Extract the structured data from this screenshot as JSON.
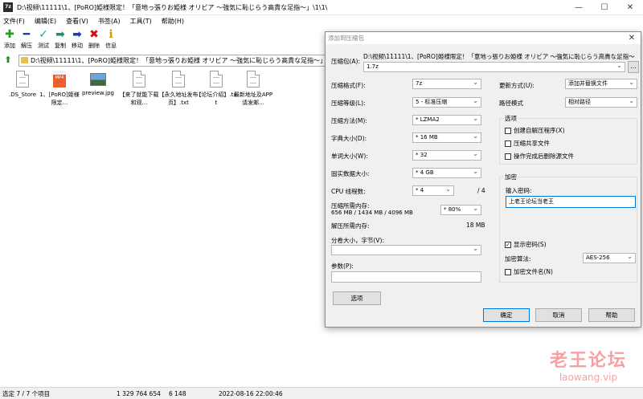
{
  "window": {
    "icon_text": "7z",
    "title": "D:\\视频\\11111\\1、[PoRO]姫様限定！「意地っ張りお姫様 オリビア ～強気に恥じらう高貴な足指～」\\1\\1\\",
    "minimize": "—",
    "maximize": "☐",
    "close": "✕"
  },
  "menu": [
    "文件(F)",
    "编辑(E)",
    "查看(V)",
    "书签(A)",
    "工具(T)",
    "帮助(H)"
  ],
  "toolbar": [
    {
      "label": "添加",
      "icon": "add-icon",
      "glyph": "✚",
      "color": "#1e9e1e"
    },
    {
      "label": "解压",
      "icon": "extract-icon",
      "glyph": "━",
      "color": "#1a3fb0"
    },
    {
      "label": "测试",
      "icon": "test-icon",
      "glyph": "✓",
      "color": "#19a0b8"
    },
    {
      "label": "复制",
      "icon": "copy-icon",
      "glyph": "➡",
      "color": "#1f8f6a"
    },
    {
      "label": "移动",
      "icon": "move-icon",
      "glyph": "➡",
      "color": "#1a3fb0"
    },
    {
      "label": "删除",
      "icon": "delete-icon",
      "glyph": "✖",
      "color": "#d01010"
    },
    {
      "label": "信息",
      "icon": "info-icon",
      "glyph": "ℹ",
      "color": "#c8a000"
    }
  ],
  "address": "D:\\视频\\11111\\1、[PoRO]姫様限定！「意地っ張りお姫様 オリビア ～強気に恥じらう高貴な足指～」\\1\\1\\",
  "files": [
    {
      "name": ".DS_Store",
      "icon": "document-icon"
    },
    {
      "name": "1、[PoRO]姫様限定...",
      "icon": "mp4-file-icon"
    },
    {
      "name": "preview.jpg",
      "icon": "image-icon"
    },
    {
      "name": "【来了就能下载和观...",
      "icon": "document-icon"
    },
    {
      "name": "【永久地址发布页】.txt",
      "icon": "document-icon"
    },
    {
      "name": "【论坛介绍】.txt",
      "icon": "document-icon"
    },
    {
      "name": "最新地址及APP请发邮...",
      "icon": "document-icon"
    }
  ],
  "mp4_badge": "MP4",
  "status": {
    "selected": "选定 7 / 7 个项目",
    "size": "1 329 764 654",
    "packed": "6 148",
    "modified": "2022-08-16 22:00:46"
  },
  "dialog": {
    "title": "添加到压缩包",
    "close": "✕",
    "archive_label": "压缩包(A):",
    "archive_path": "D:\\视频\\11111\\1、[PoRO]姫様限定！「意地っ張りお姫様 オリビア ～強気に恥じらう高貴な足指～",
    "archive_name": "1.7z",
    "browse": "...",
    "format_label": "压缩格式(F):",
    "format": "7z",
    "level_label": "压缩等级(L):",
    "level": "5 - 标准压缩",
    "method_label": "压缩方法(M):",
    "method": "* LZMA2",
    "dict_label": "字典大小(D):",
    "dict": "* 16 MB",
    "word_label": "单词大小(W):",
    "word": "* 32",
    "solid_label": "固实数据大小:",
    "solid": "* 4 GB",
    "cpu_label": "CPU 线程数:",
    "cpu": "* 4",
    "cpu_max": "/ 4",
    "mem_label": "压缩所需内存:",
    "mem_values": "656 MB / 1434 MB / 4096 MB",
    "mem_pct": "* 80%",
    "dmem_label": "解压所需内存:",
    "dmem": "18 MB",
    "split_label": "分卷大小，字节(V):",
    "params_label": "参数(P):",
    "options_button": "选项",
    "update_label": "更新方式(U):",
    "update": "添加并替换文件",
    "path_label": "路径模式",
    "path": "相对路径",
    "options_title": "选项",
    "opt_sfx": "创建自解压程序(X)",
    "opt_shared": "压缩共享文件",
    "opt_delete": "操作完成后删除源文件",
    "enc_title": "加密",
    "pwd_label": "输入密码:",
    "pwd": "上老王论坛当老王",
    "show_pwd": "显示密码(S)",
    "show_pwd_mark": "✓",
    "enc_method_label": "加密算法:",
    "enc_method": "AES-256",
    "enc_names": "加密文件名(N)",
    "ok": "确定",
    "cancel": "取消",
    "help": "帮助"
  },
  "watermark": {
    "title": "老王论坛",
    "url": "laowang.vip"
  }
}
